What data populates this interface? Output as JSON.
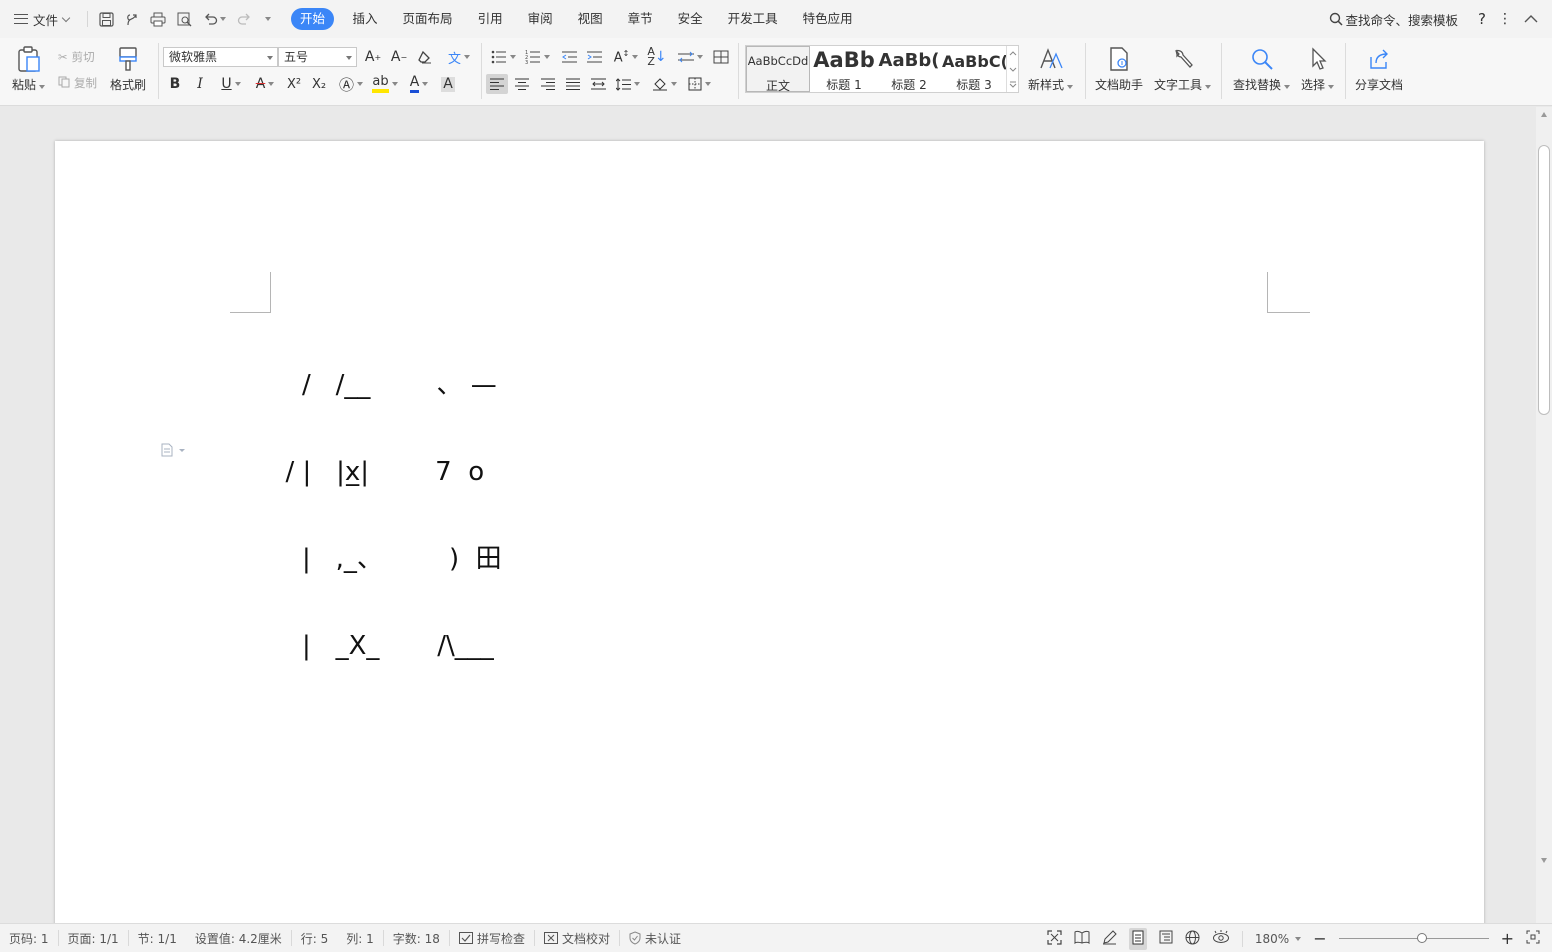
{
  "menubar": {
    "file_label": "文件",
    "tabs": [
      "开始",
      "插入",
      "页面布局",
      "引用",
      "审阅",
      "视图",
      "章节",
      "安全",
      "开发工具",
      "特色应用"
    ],
    "search_label": "查找命令、搜索模板",
    "help_label": "?"
  },
  "ribbon": {
    "paste": "粘贴",
    "cut": "剪切",
    "copy": "复制",
    "format_painter": "格式刷",
    "font_name": "微软雅黑",
    "font_size": "五号",
    "bold": "B",
    "italic": "I",
    "underline": "U",
    "strike": "A",
    "superscript": "X²",
    "subscript": "X₂",
    "styles": [
      {
        "sample": "AaBbCcDd",
        "name": "正文"
      },
      {
        "sample": "AaBb",
        "name": "标题 1"
      },
      {
        "sample": "AaBb(",
        "name": "标题 2"
      },
      {
        "sample": "AaBbC(",
        "name": "标题 3"
      }
    ],
    "new_style": "新样式",
    "doc_assistant": "文档助手",
    "text_tools": "文字工具",
    "find_replace": "查找替换",
    "select": "选择",
    "share_doc": "分享文档"
  },
  "document": {
    "lines": [
      "    /   /__        、 —",
      "  / |   |x̲|        7  o",
      "    |   ,_、        )  田",
      "    |   _X_       /\\___"
    ]
  },
  "statusbar": {
    "page_num": "页码: 1",
    "pages": "页面: 1/1",
    "section": "节: 1/1",
    "setting": "设置值: 4.2厘米",
    "row": "行: 5",
    "col": "列: 1",
    "word_count": "字数: 18",
    "spell_check": "拼写检查",
    "doc_proof": "文档校对",
    "certified": "未认证",
    "zoom": "180%"
  }
}
